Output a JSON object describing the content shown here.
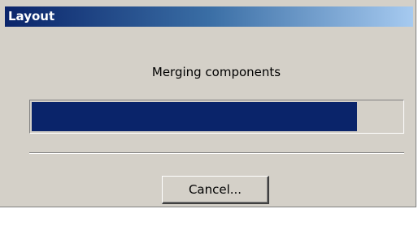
{
  "window": {
    "title": "Layout"
  },
  "message": "Merging components",
  "progress": {
    "fraction": 0.88,
    "fill_color": "#0a246a"
  },
  "buttons": {
    "cancel_label": "Cancel..."
  }
}
